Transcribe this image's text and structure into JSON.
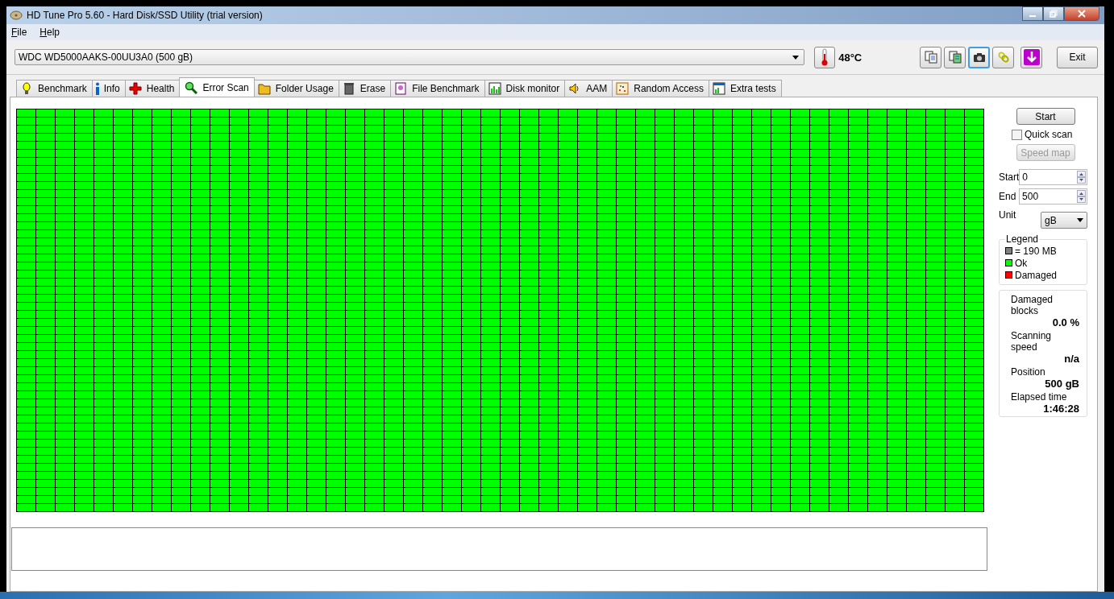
{
  "window": {
    "title": "HD Tune Pro 5.60 - Hard Disk/SSD Utility (trial version)"
  },
  "menu": [
    {
      "label": "File"
    },
    {
      "label": "Help"
    }
  ],
  "drive": {
    "value": "WDC WD5000AAKS-00UU3A0 (500 gB)"
  },
  "temperature": "48°C",
  "toolbar": [
    {
      "kind": "copy",
      "selected": false
    },
    {
      "kind": "copy-compare",
      "selected": false
    },
    {
      "kind": "camera",
      "selected": true
    },
    {
      "kind": "chain",
      "selected": false
    },
    {
      "kind": "download",
      "selected": false
    }
  ],
  "exit_button": "Exit",
  "tabs": [
    {
      "label": "Benchmark",
      "kind": "bulb",
      "selected": false
    },
    {
      "label": "Info",
      "kind": "info",
      "selected": false
    },
    {
      "label": "Health",
      "kind": "cross",
      "selected": false
    },
    {
      "label": "Error Scan",
      "kind": "magnifier",
      "selected": true
    },
    {
      "label": "Folder Usage",
      "kind": "folder",
      "selected": false
    },
    {
      "label": "Erase",
      "kind": "bin",
      "selected": false
    },
    {
      "label": "File Benchmark",
      "kind": "file",
      "selected": false
    },
    {
      "label": "Disk monitor",
      "kind": "bars",
      "selected": false
    },
    {
      "label": "AAM",
      "kind": "speaker",
      "selected": false
    },
    {
      "label": "Random Access",
      "kind": "dots",
      "selected": false
    },
    {
      "label": "Extra tests",
      "kind": "sheet",
      "selected": false
    }
  ],
  "panel": {
    "start_button": "Start",
    "quick_scan": {
      "label": "Quick scan",
      "checked": false
    },
    "speed_map": {
      "label": "Speed map",
      "disabled": true
    },
    "fields": [
      {
        "label": "Start",
        "value": "0"
      },
      {
        "label": "End",
        "value": "500"
      }
    ],
    "unit": {
      "label": "Unit",
      "value": "gB"
    },
    "legend": {
      "title": "Legend",
      "items": [
        {
          "label": "= 190 MB",
          "color": "#808080"
        },
        {
          "label": "Ok",
          "color": "#00ff00"
        },
        {
          "label": "Damaged",
          "color": "#ff0000"
        }
      ]
    },
    "stats": [
      {
        "label": "Damaged blocks",
        "value": "0.0 %"
      },
      {
        "label": "Scanning speed",
        "value": "n/a"
      },
      {
        "label": "Position",
        "value": "500 gB"
      },
      {
        "label": "Elapsed time",
        "value": "1:46:28"
      }
    ]
  }
}
